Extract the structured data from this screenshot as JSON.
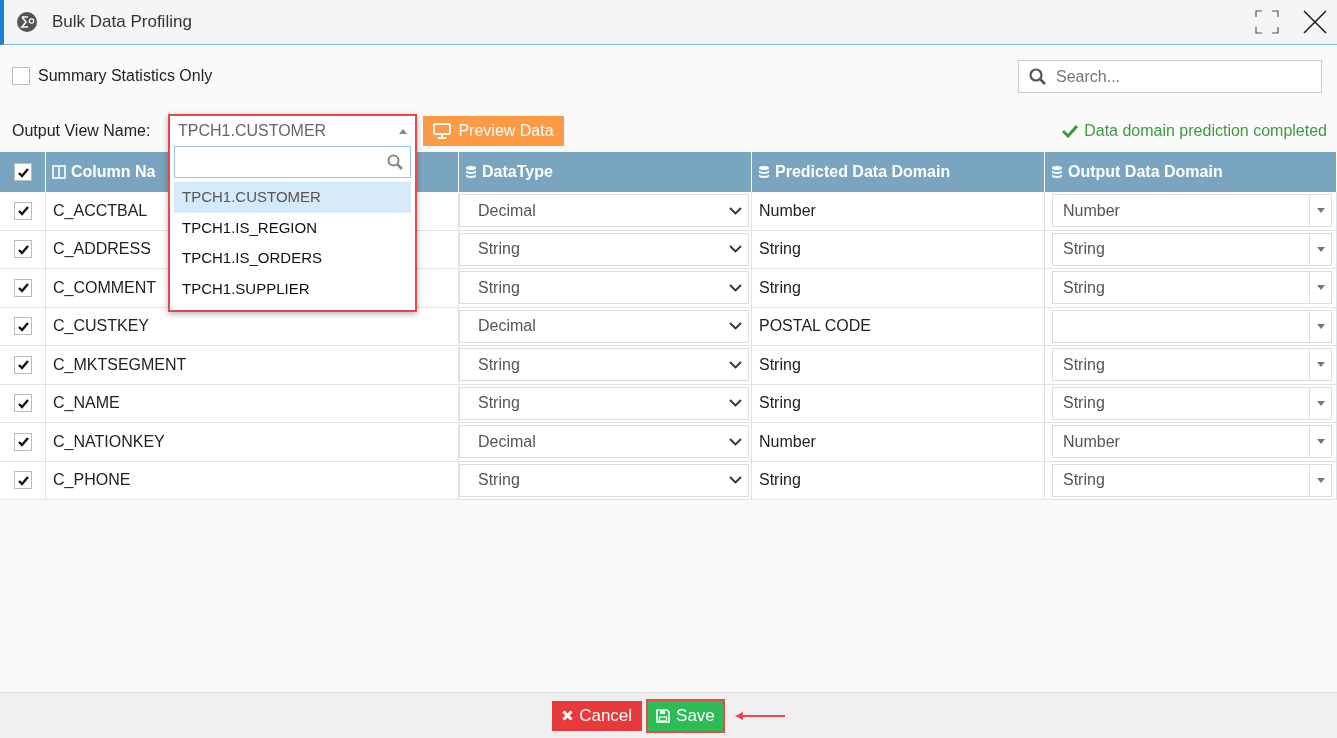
{
  "window": {
    "title": "Bulk Data Profiling"
  },
  "summary_only": {
    "label": "Summary Statistics Only",
    "checked": false
  },
  "search": {
    "placeholder": "Search..."
  },
  "output_view": {
    "label": "Output View Name:",
    "value": "TPCH1.CUSTOMER",
    "expanded": true,
    "options": [
      {
        "label": "TPCH1.CUSTOMER",
        "selected": true
      },
      {
        "label": "TPCH1.IS_REGION",
        "selected": false
      },
      {
        "label": "TPCH1.IS_ORDERS",
        "selected": false
      },
      {
        "label": "TPCH1.SUPPLIER",
        "selected": false
      }
    ]
  },
  "preview_button": "Preview Data",
  "status": "Data domain prediction completed",
  "table": {
    "all_checked": true,
    "columns": [
      "Column Na",
      "DataType",
      "Predicted Data Domain",
      "Output Data Domain"
    ],
    "rows": [
      {
        "checked": true,
        "name": "C_ACCTBAL",
        "data_type": "Decimal",
        "predicted": "Number",
        "output": "Number"
      },
      {
        "checked": true,
        "name": "C_ADDRESS",
        "data_type": "String",
        "predicted": "String",
        "output": "String"
      },
      {
        "checked": true,
        "name": "C_COMMENT",
        "data_type": "String",
        "predicted": "String",
        "output": "String"
      },
      {
        "checked": true,
        "name": "C_CUSTKEY",
        "data_type": "Decimal",
        "predicted": "POSTAL CODE"
      },
      {
        "checked": true,
        "name": "C_MKTSEGMENT",
        "data_type": "String",
        "predicted": "String",
        "output": "String"
      },
      {
        "checked": true,
        "name": "C_NAME",
        "data_type": "String",
        "predicted": "String",
        "output": "String"
      },
      {
        "checked": true,
        "name": "C_NATIONKEY",
        "data_type": "Decimal",
        "predicted": "Number",
        "output": "Number"
      },
      {
        "checked": true,
        "name": "C_PHONE",
        "data_type": "String",
        "predicted": "String",
        "output": "String"
      }
    ]
  },
  "buttons": {
    "cancel": "Cancel",
    "save": "Save"
  }
}
